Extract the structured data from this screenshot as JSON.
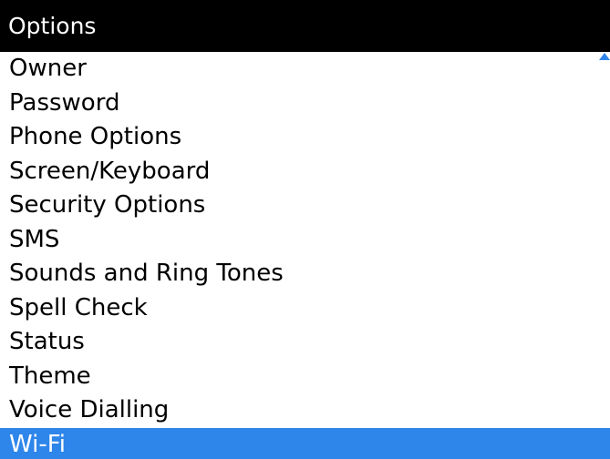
{
  "header": {
    "title": "Options"
  },
  "menu": {
    "items": [
      {
        "label": "Owner"
      },
      {
        "label": "Password"
      },
      {
        "label": "Phone Options"
      },
      {
        "label": "Screen/Keyboard"
      },
      {
        "label": "Security Options"
      },
      {
        "label": "SMS"
      },
      {
        "label": "Sounds and Ring Tones"
      },
      {
        "label": "Spell Check"
      },
      {
        "label": "Status"
      },
      {
        "label": "Theme"
      },
      {
        "label": "Voice Dialling"
      },
      {
        "label": "Wi-Fi"
      }
    ],
    "selected_label": "Wi-Fi"
  },
  "icons": {
    "scroll_indicator": "scroll-up-icon"
  },
  "colors": {
    "title_bar": "#000000",
    "title_text": "#ffffff",
    "selection": "#2f86ea",
    "selected_text": "#ffffff",
    "item_text": "#000000",
    "background": "#ffffff"
  }
}
